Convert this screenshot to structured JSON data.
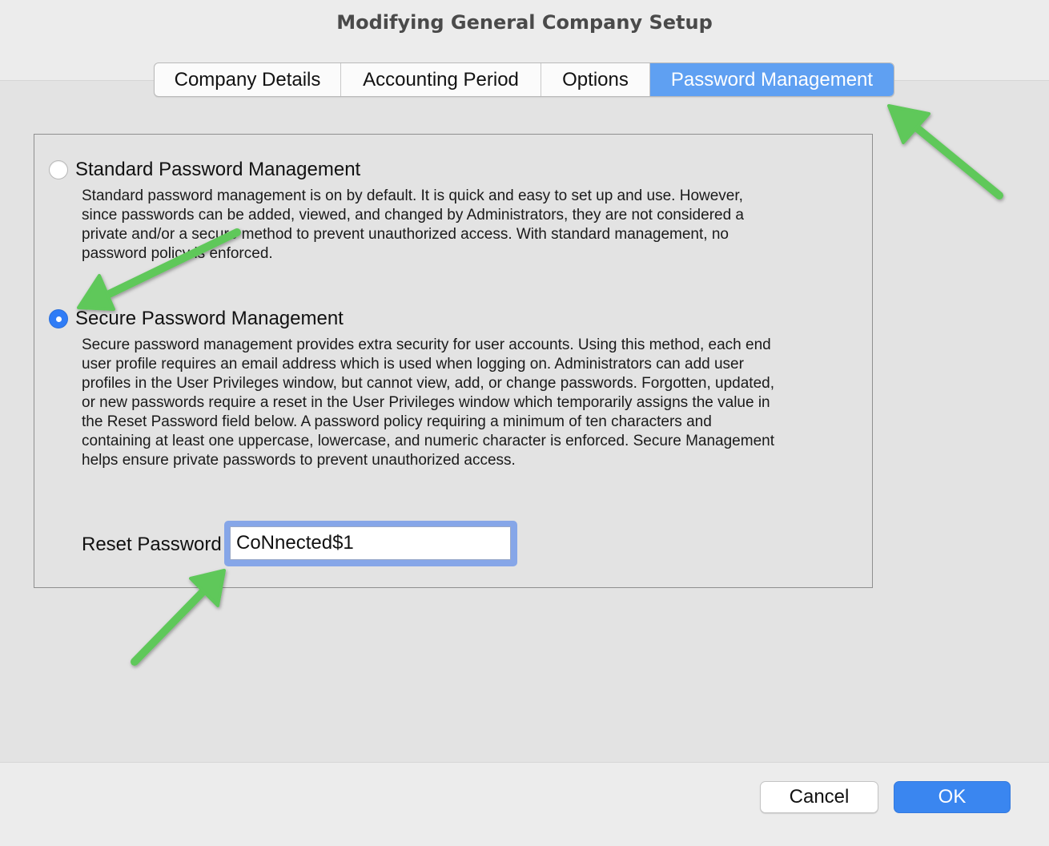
{
  "window": {
    "title": "Modifying General Company Setup"
  },
  "tabs": [
    {
      "label": "Company Details",
      "active": false
    },
    {
      "label": "Accounting Period",
      "active": false
    },
    {
      "label": "Options",
      "active": false
    },
    {
      "label": "Password Management",
      "active": true
    }
  ],
  "standard": {
    "label": "Standard Password Management",
    "selected": false,
    "description_lines": [
      "Standard password management is on by default. It is quick and easy to set up and use. However,",
      "since passwords can be added, viewed, and changed by Administrators, they are not considered a",
      "private and/or a secure method to prevent unauthorized access. With standard management, no",
      "password policy is enforced."
    ]
  },
  "secure": {
    "label": "Secure Password Management",
    "selected": true,
    "description_lines": [
      "Secure password management provides extra security for user accounts. Using this method, each end",
      "user profile requires an email address which is used when logging on. Administrators can add user",
      "profiles in the User Privileges window, but cannot view, add, or change passwords. Forgotten, updated,",
      "or new passwords require a reset in the User Privileges window which temporarily assigns the value in",
      "the Reset Password field below. A password policy requiring a minimum of ten characters and",
      "containing at least one uppercase, lowercase, and numeric character is enforced. Secure Management",
      "helps ensure private passwords to prevent unauthorized access."
    ]
  },
  "reset_password": {
    "label": "Reset Password",
    "value": "CoNnected$1"
  },
  "buttons": {
    "cancel": "Cancel",
    "ok": "OK"
  },
  "colors": {
    "accent": "#3a86f0",
    "tab_active": "#5fa0f2",
    "annotation_arrow": "#5ec85a"
  }
}
